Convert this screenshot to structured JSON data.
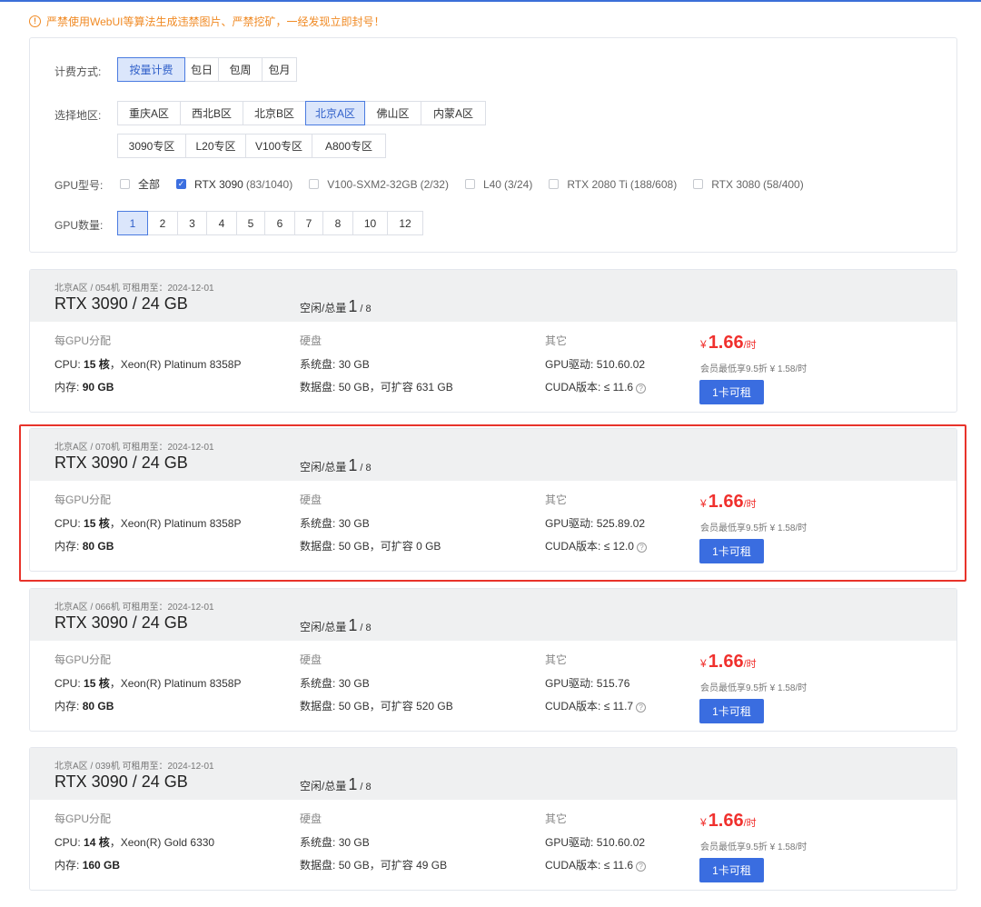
{
  "notice": {
    "text": "严禁使用WebUI等算法生成违禁图片、严禁挖矿，一经发现立即封号！"
  },
  "filters": {
    "billing": {
      "label": "计费方式:",
      "options": [
        "按量计费",
        "包日",
        "包周",
        "包月"
      ],
      "selected": "按量计费"
    },
    "region": {
      "label": "选择地区:",
      "row1": [
        "重庆A区",
        "西北B区",
        "北京B区",
        "北京A区",
        "佛山区",
        "内蒙A区"
      ],
      "row2": [
        "3090专区",
        "L20专区",
        "V100专区",
        "A800专区"
      ],
      "selected": "北京A区"
    },
    "gpu_model": {
      "label": "GPU型号:",
      "options": [
        {
          "name": "全部",
          "count": "",
          "checked": false
        },
        {
          "name": "RTX 3090",
          "count": "(83/1040)",
          "checked": true
        },
        {
          "name": "V100-SXM2-32GB",
          "count": "(2/32)",
          "checked": false
        },
        {
          "name": "L40",
          "count": "(3/24)",
          "checked": false
        },
        {
          "name": "RTX 2080 Ti",
          "count": "(188/608)",
          "checked": false
        },
        {
          "name": "RTX 3080",
          "count": "(58/400)",
          "checked": false
        }
      ]
    },
    "gpu_count": {
      "label": "GPU数量:",
      "options": [
        "1",
        "2",
        "3",
        "4",
        "5",
        "6",
        "7",
        "8",
        "10",
        "12"
      ],
      "selected": "1"
    }
  },
  "labels": {
    "idle_total": "空闲/总量",
    "per_gpu": "每GPU分配",
    "disk": "硬盘",
    "other": "其它",
    "cpu": "CPU:",
    "mem": "内存:",
    "sys_disk": "系统盘:",
    "data_disk": "数据盘:",
    "gpu_driver": "GPU驱动:",
    "cuda": "CUDA版本:",
    "expand": "可扩容",
    "price_yen": "¥",
    "price_unit": "/时",
    "rent_button": "1卡可租"
  },
  "machines": [
    {
      "meta": "北京A区 / 054机  可租用至：2024-12-01",
      "title": "RTX 3090 / 24 GB",
      "idle": "1",
      "total": "/ 8",
      "cpu_cores": "15 核",
      "cpu_model": "，Xeon(R) Platinum 8358P",
      "mem": "90 GB",
      "sys_disk": "30 GB",
      "data_disk": "50 GB，",
      "expand": "631 GB",
      "driver": "510.60.02",
      "cuda": "≤ 11.6",
      "price": "1.66",
      "member": "会员最低享9.5折 ¥ 1.58/时"
    },
    {
      "meta": "北京A区 / 070机  可租用至：2024-12-01",
      "title": "RTX 3090 / 24 GB",
      "idle": "1",
      "total": "/ 8",
      "cpu_cores": "15 核",
      "cpu_model": "，Xeon(R) Platinum 8358P",
      "mem": "80 GB",
      "sys_disk": "30 GB",
      "data_disk": "50 GB，",
      "expand": "0 GB",
      "driver": "525.89.02",
      "cuda": "≤ 12.0",
      "price": "1.66",
      "member": "会员最低享9.5折 ¥ 1.58/时"
    },
    {
      "meta": "北京A区 / 066机  可租用至：2024-12-01",
      "title": "RTX 3090 / 24 GB",
      "idle": "1",
      "total": "/ 8",
      "cpu_cores": "15 核",
      "cpu_model": "，Xeon(R) Platinum 8358P",
      "mem": "80 GB",
      "sys_disk": "30 GB",
      "data_disk": "50 GB，",
      "expand": "520 GB",
      "driver": "515.76",
      "cuda": "≤ 11.7",
      "price": "1.66",
      "member": "会员最低享9.5折 ¥ 1.58/时"
    },
    {
      "meta": "北京A区 / 039机  可租用至：2024-12-01",
      "title": "RTX 3090 / 24 GB",
      "idle": "1",
      "total": "/ 8",
      "cpu_cores": "14 核",
      "cpu_model": "，Xeon(R) Gold 6330",
      "mem": "160 GB",
      "sys_disk": "30 GB",
      "data_disk": "50 GB，",
      "expand": "49 GB",
      "driver": "510.60.02",
      "cuda": "≤ 11.6",
      "price": "1.66",
      "member": "会员最低享9.5折 ¥ 1.58/时"
    }
  ],
  "colors": {
    "accent": "#3a6de0",
    "price": "#f0312e",
    "warning": "#f08a24",
    "highlight": "#e8332b"
  }
}
